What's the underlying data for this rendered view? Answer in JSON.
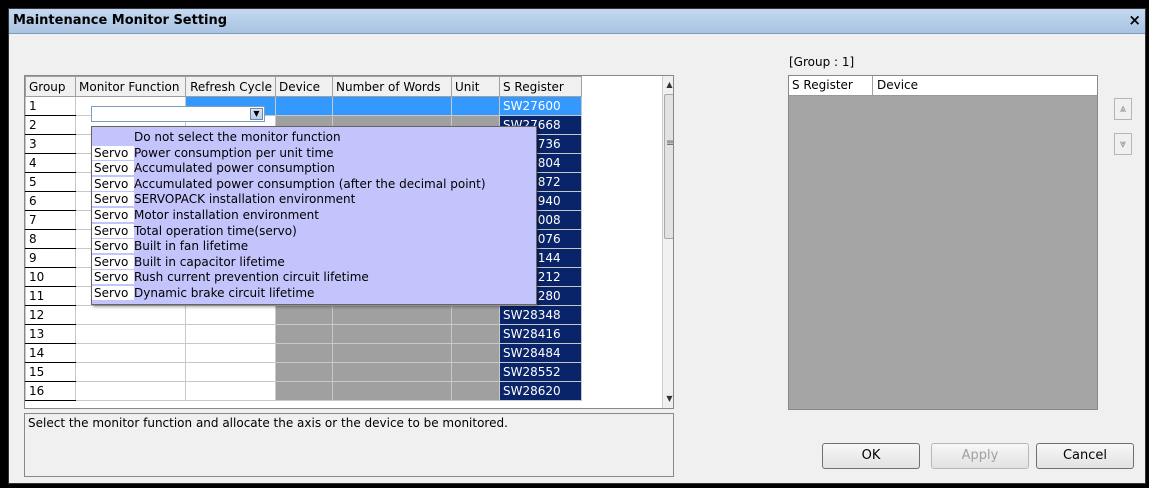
{
  "window": {
    "title": "Maintenance Monitor Setting",
    "close_glyph": "×"
  },
  "grid": {
    "headers": [
      "Group",
      "Monitor Function",
      "Refresh Cycle",
      "Device",
      "Number of Words",
      "Unit",
      "S Register"
    ],
    "rows": [
      {
        "group": "1",
        "sreg": "SW27600"
      },
      {
        "group": "2",
        "sreg": "SW27668"
      },
      {
        "group": "3",
        "sreg": "SW27736"
      },
      {
        "group": "4",
        "sreg": "SW27804"
      },
      {
        "group": "5",
        "sreg": "SW27872"
      },
      {
        "group": "6",
        "sreg": "SW27940"
      },
      {
        "group": "7",
        "sreg": "SW28008"
      },
      {
        "group": "8",
        "sreg": "SW28076"
      },
      {
        "group": "9",
        "sreg": "SW28144"
      },
      {
        "group": "10",
        "sreg": "SW28212"
      },
      {
        "group": "11",
        "sreg": "SW28280"
      },
      {
        "group": "12",
        "sreg": "SW28348"
      },
      {
        "group": "13",
        "sreg": "SW28416"
      },
      {
        "group": "14",
        "sreg": "SW28484"
      },
      {
        "group": "15",
        "sreg": "SW28552"
      },
      {
        "group": "16",
        "sreg": "SW28620"
      }
    ],
    "combo_value": ""
  },
  "dropdown": {
    "options": [
      {
        "prefix": "",
        "label": "Do not select the monitor function"
      },
      {
        "prefix": "Servo",
        "label": "Power consumption per unit time"
      },
      {
        "prefix": "Servo",
        "label": "Accumulated power consumption"
      },
      {
        "prefix": "Servo",
        "label": "Accumulated power consumption (after the decimal point)"
      },
      {
        "prefix": "Servo",
        "label": "SERVOPACK installation environment"
      },
      {
        "prefix": "Servo",
        "label": "Motor installation environment"
      },
      {
        "prefix": "Servo",
        "label": "Total operation time(servo)"
      },
      {
        "prefix": "Servo",
        "label": "Built in fan lifetime"
      },
      {
        "prefix": "Servo",
        "label": "Built in capacitor lifetime"
      },
      {
        "prefix": "Servo",
        "label": "Rush current prevention circuit lifetime"
      },
      {
        "prefix": "Servo",
        "label": "Dynamic brake circuit lifetime"
      }
    ]
  },
  "message": "Select the monitor function and allocate the axis or the device to be monitored.",
  "right_panel": {
    "group_label": "[Group : 1]",
    "headers": [
      "S Register",
      "Device"
    ],
    "up_glyph": "⩓",
    "down_glyph": "⩔"
  },
  "buttons": {
    "ok": "OK",
    "apply": "Apply",
    "cancel": "Cancel"
  },
  "scrollbar": {
    "up_glyph": "▲",
    "down_glyph": "▼",
    "grip_glyph": "≡"
  }
}
